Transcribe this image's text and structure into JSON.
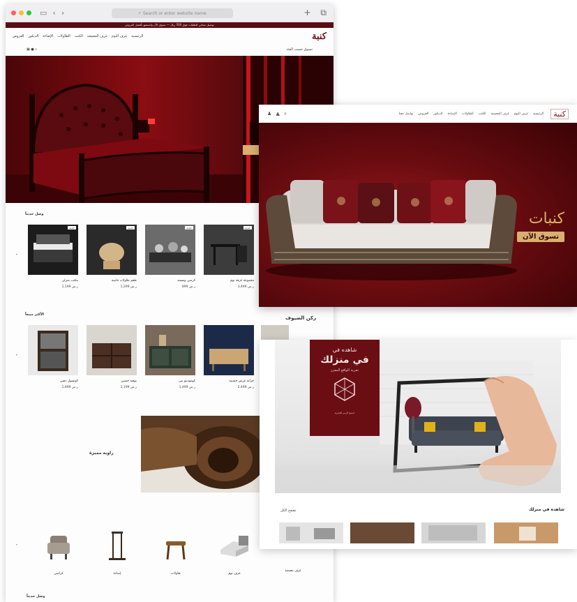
{
  "back_window": {
    "address_placeholder": "Search or enter website name",
    "announcement": "توصيل مجاني للطلبات فوق 500 ريال — تسوق الآن واستمتع بأفضل العروض",
    "nav_links": [
      "الرئيسية",
      "غرف النوم",
      "غرف المعيشة",
      "الكنب",
      "الطاولات",
      "الإضاءة",
      "الديكور",
      "العروض"
    ],
    "logo": "كنبة",
    "sub_label": "تسوق حسب الفئة",
    "section1_title": "وصل حديثاً",
    "section1_products": [
      {
        "tag": "جديد",
        "name": "مجموعة غرفة نوم",
        "price": "3,499 ر.س"
      },
      {
        "tag": "جديد",
        "name": "كرسي ومسند",
        "price": "899 ر.س"
      },
      {
        "tag": "جديد",
        "name": "طقم طاولات جانبية",
        "price": "1,299 ر.س"
      },
      {
        "tag": "جديد",
        "name": "مكتب منزلي",
        "price": "1,199 ر.س"
      }
    ],
    "section2_title": "الأكثر مبيعاً",
    "section2_products": [
      {
        "name": "خزانة عرض خشبية",
        "price": "2,499 ر.س"
      },
      {
        "name": "كومودينو بني",
        "price": "1,499 ر.س"
      },
      {
        "name": "بوفيه خشبي",
        "price": "2,199 ر.س"
      },
      {
        "name": "كونسول ذهبي",
        "price": "1,899 ر.س"
      }
    ],
    "side_label": "زاوية مميزة",
    "front_label": "ركن الضيوف",
    "categories": [
      "كراسي",
      "إضاءة",
      "طاولات",
      "غرف نوم",
      "غرف معيشة"
    ],
    "bottom_title": "وصل حديثاً"
  },
  "front_window_1": {
    "logo": "كنبة",
    "nav_links": [
      "الرئيسية",
      "غرف النوم",
      "غرف المعيشة",
      "الكنب",
      "الطاولات",
      "الإضاءة",
      "الديكور",
      "العروض",
      "تواصل معنا"
    ],
    "hero_title": "كنبات",
    "hero_button": "تسوق الآن"
  },
  "front_window_2": {
    "ar_line1": "شاهده في",
    "ar_line2": "في منزلك",
    "ar_line3": "تجربة الواقع المعزز",
    "ar_line4": "امسح الرمز للتجربة",
    "strip_title": "شاهده في منزلك",
    "strip_sub": "تصفح الكل"
  },
  "colors": {
    "brand": "#7a1218",
    "gold": "#d8b070",
    "dark_red": "#5a0d12"
  }
}
